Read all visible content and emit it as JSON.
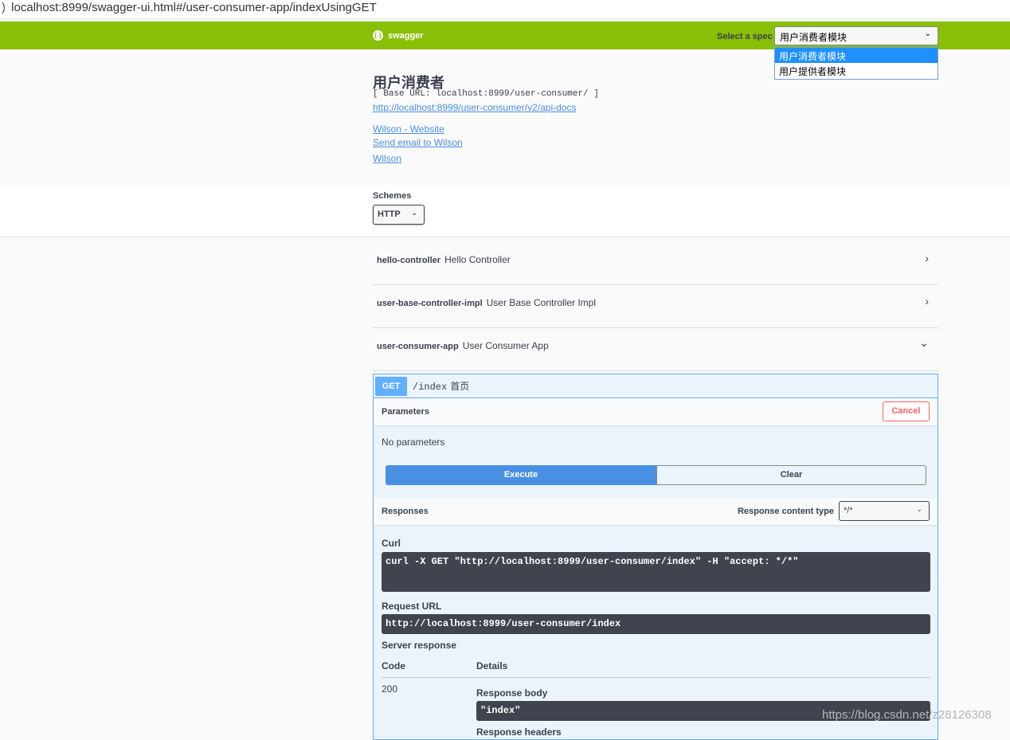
{
  "address_bar": {
    "url": "localhost:8999/swagger-ui.html#/user-consumer-app/indexUsingGET"
  },
  "topbar": {
    "logo_text": "swagger",
    "spec_label": "Select a spec",
    "spec_selected": "用户消费者模块",
    "spec_options": [
      "用户消费者模块",
      "用户提供者模块"
    ]
  },
  "info": {
    "title": "用户消费者",
    "base_url": "[ Base URL: localhost:8999/user-consumer/ ]",
    "api_docs_link": "http://localhost:8999/user-consumer/v2/api-docs",
    "website_link": "Wilson - Website",
    "email_link": "Send email to Wilson",
    "license_link": "Wilson"
  },
  "schemes": {
    "label": "Schemes",
    "selected": "HTTP"
  },
  "tags": [
    {
      "name": "hello-controller",
      "desc": "Hello Controller",
      "arrow": "›"
    },
    {
      "name": "user-base-controller-impl",
      "desc": "User Base Controller Impl",
      "arrow": "›"
    },
    {
      "name": "user-consumer-app",
      "desc": "User Consumer App",
      "arrow": "⌄"
    }
  ],
  "operation": {
    "method": "GET",
    "path": "/index",
    "summary": "首页",
    "parameters_title": "Parameters",
    "cancel_label": "Cancel",
    "no_params": "No parameters",
    "execute_label": "Execute",
    "clear_label": "Clear",
    "responses_title": "Responses",
    "response_content_type_label": "Response content type",
    "response_content_type": "*/*",
    "curl_label": "Curl",
    "curl": "curl -X GET \"http://localhost:8999/user-consumer/index\" -H \"accept: */*\"",
    "request_url_label": "Request URL",
    "request_url": "http://localhost:8999/user-consumer/index",
    "server_response_label": "Server response",
    "code_header": "Code",
    "details_header": "Details",
    "code": "200",
    "response_body_label": "Response body",
    "response_body": "\"index\"",
    "response_headers_label": "Response headers"
  },
  "watermark": "https://blog.csdn.net/z28126308"
}
